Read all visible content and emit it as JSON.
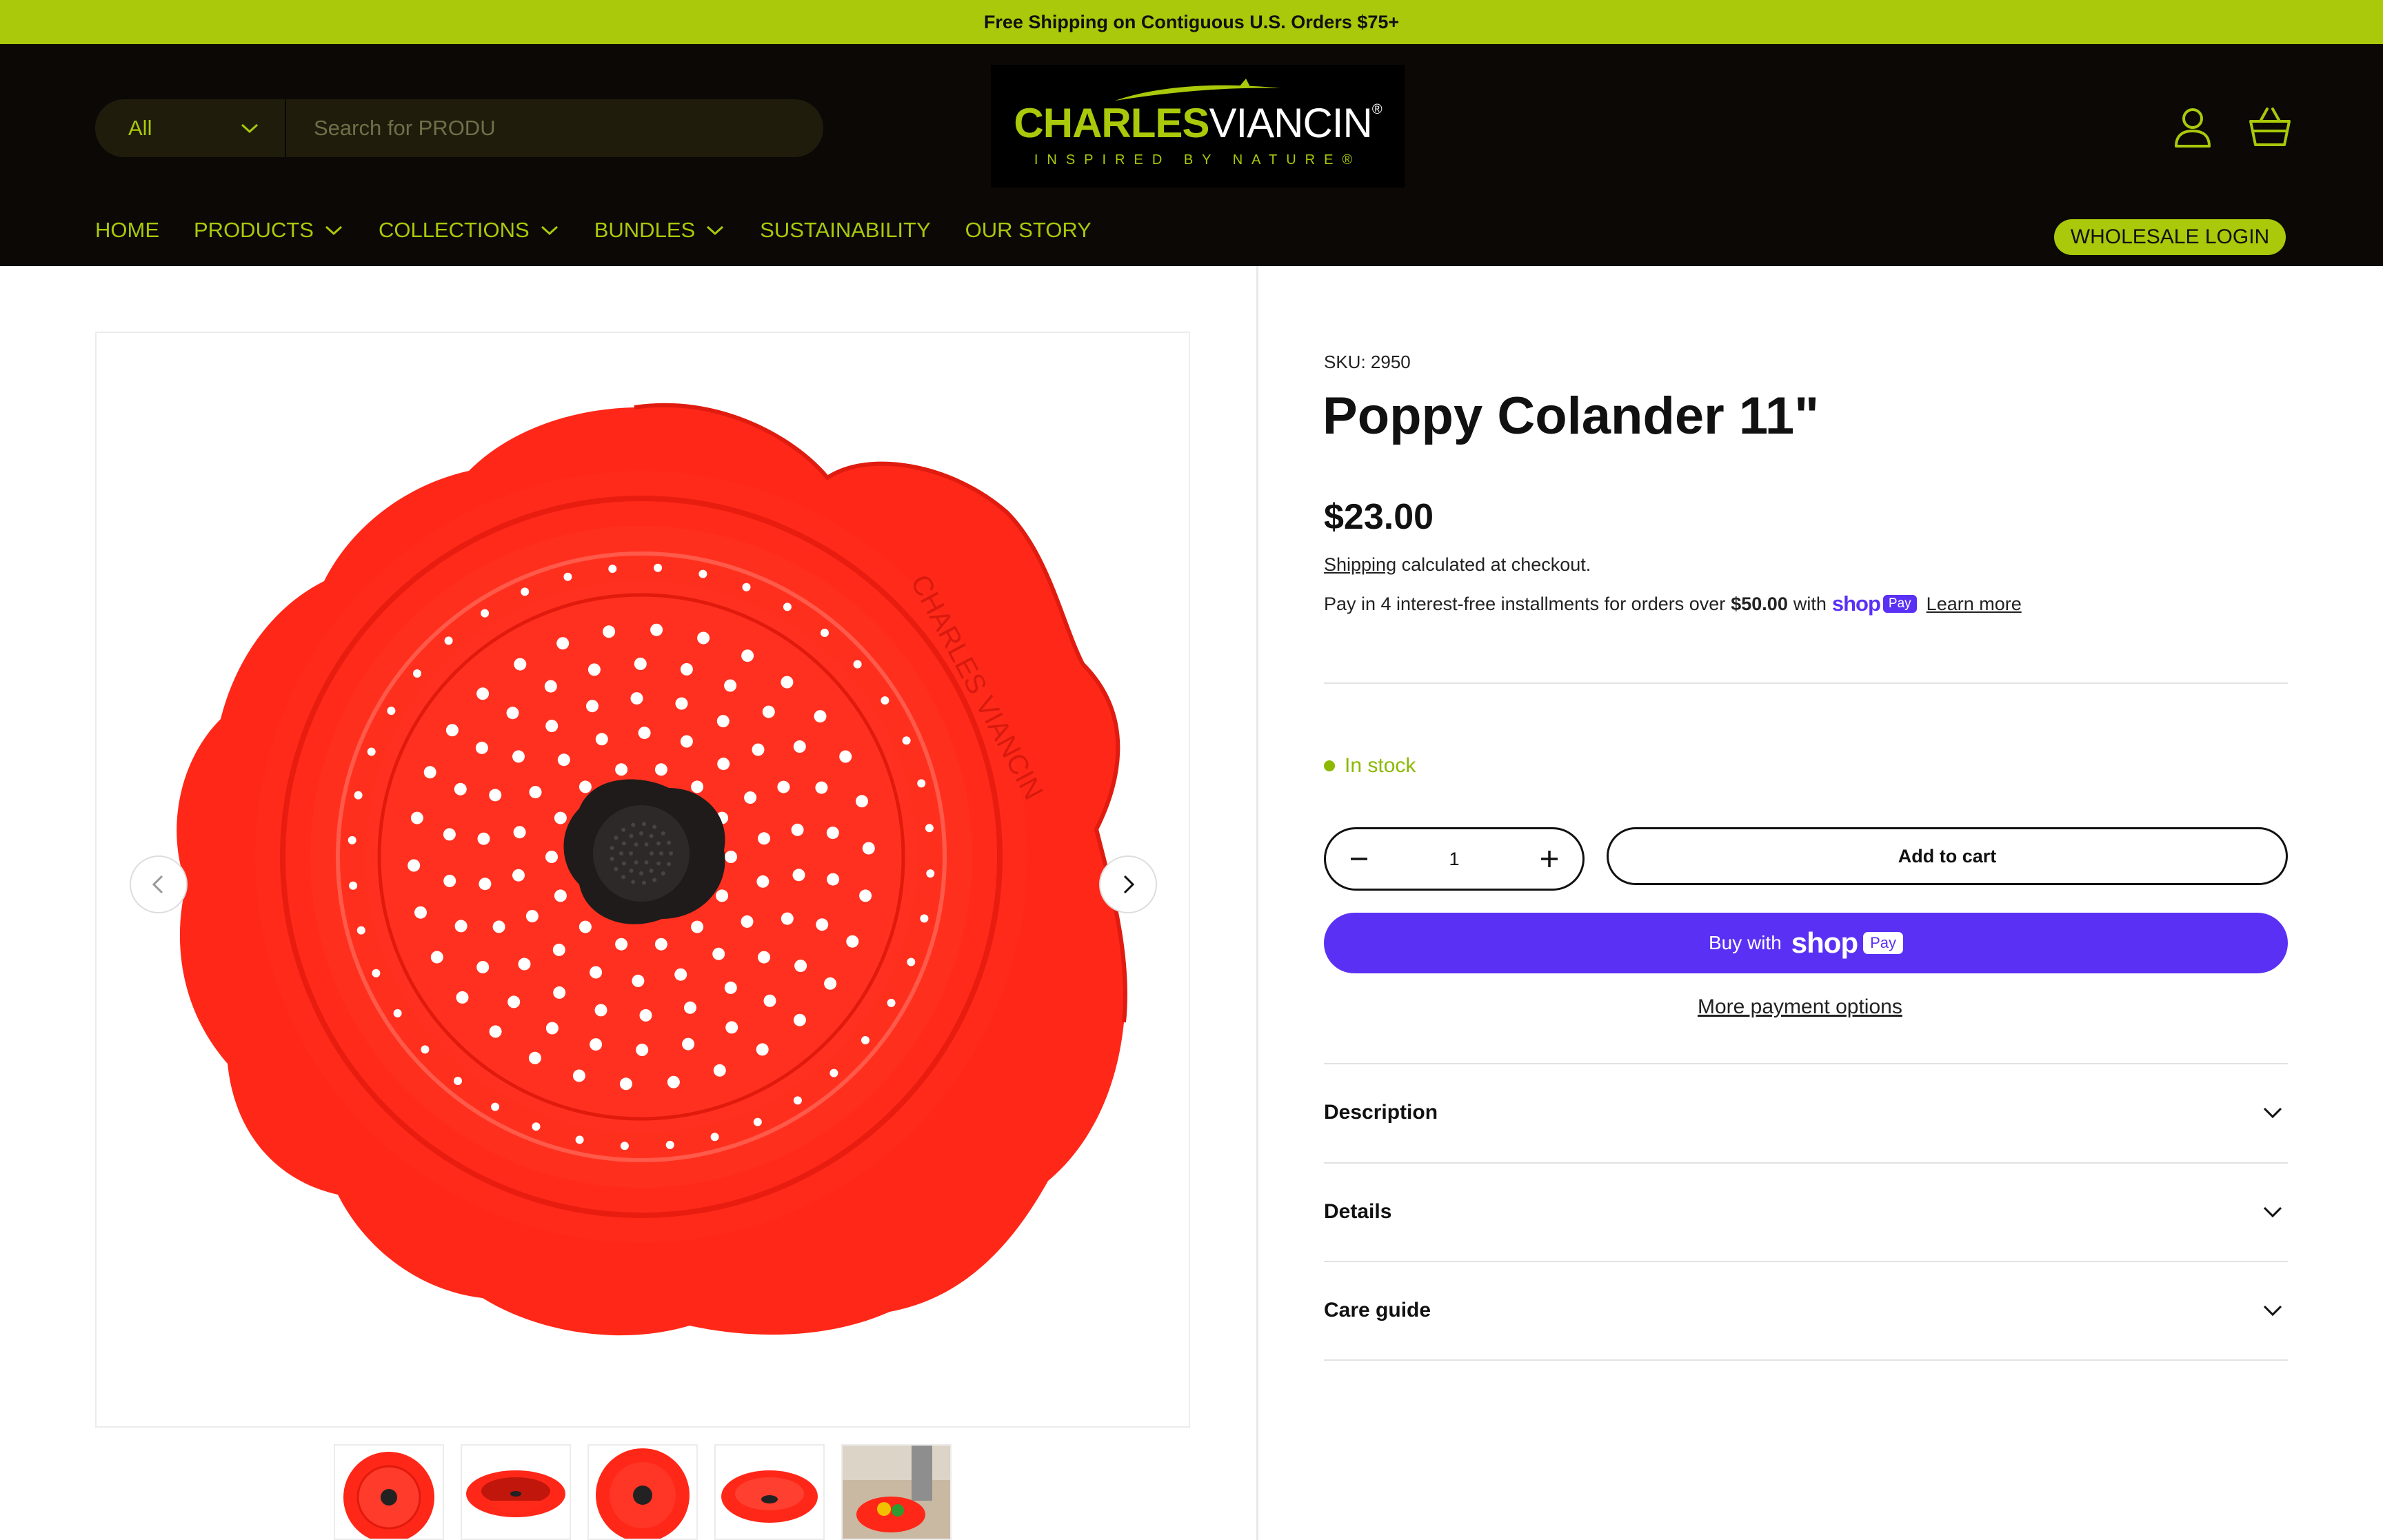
{
  "announcement": "Free Shipping on Contiguous U.S. Orders $75+",
  "search": {
    "category": "All",
    "placeholder": "Search for PRODU"
  },
  "logo": {
    "brand_part1": "CHARLES",
    "brand_part2": "VIANCIN",
    "registered": "®",
    "tagline": "INSPIRED BY NATURE®"
  },
  "nav": {
    "items": [
      {
        "label": "HOME",
        "dropdown": false
      },
      {
        "label": "PRODUCTS",
        "dropdown": true
      },
      {
        "label": "COLLECTIONS",
        "dropdown": true
      },
      {
        "label": "BUNDLES",
        "dropdown": true
      },
      {
        "label": "SUSTAINABILITY",
        "dropdown": false
      },
      {
        "label": "OUR STORY",
        "dropdown": false
      }
    ],
    "wholesale": "WHOLESALE LOGIN"
  },
  "product": {
    "sku": "SKU: 2950",
    "title": "Poppy Colander 11\"",
    "price": "$23.00",
    "shipping_link": "Shipping",
    "shipping_text": " calculated at checkout.",
    "installments_text": "Pay in 4 interest-free installments for orders over",
    "installments_amount": "$50.00",
    "installments_with": "with",
    "shop_word": "shop",
    "pay_word": "Pay",
    "learn_more": "Learn more",
    "stock": "In stock",
    "quantity": "1",
    "add_to_cart": "Add to cart",
    "buy_with": "Buy with",
    "more_payment": "More payment options",
    "thumbnail_count": 5
  },
  "accordion": [
    {
      "label": "Description"
    },
    {
      "label": "Details"
    },
    {
      "label": "Care guide"
    }
  ],
  "colors": {
    "accent_green": "#a9c90a",
    "header_bg": "#0b0806",
    "shop_pay_purple": "#5a31f4",
    "product_red": "#ff2415"
  },
  "icons": [
    "chevron-down-icon",
    "account-icon",
    "basket-icon",
    "chevron-left-icon",
    "chevron-right-icon",
    "minus-icon",
    "plus-icon"
  ]
}
